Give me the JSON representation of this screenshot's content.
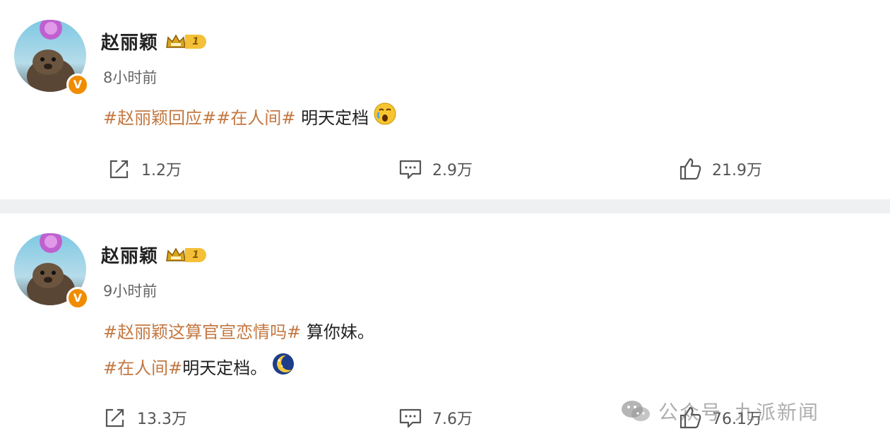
{
  "posts": [
    {
      "author": "赵丽颖",
      "level": "1",
      "time": "8小时前",
      "lines": [
        {
          "tags": [
            "#赵丽颖回应#",
            "#在人间#"
          ],
          "text": " 明天定档"
        }
      ],
      "share": "1.2万",
      "comment": "2.9万",
      "like": "21.9万"
    },
    {
      "author": "赵丽颖",
      "level": "1",
      "time": "9小时前",
      "lines": [
        {
          "tags": [
            "#赵丽颖这算官宣恋情吗#"
          ],
          "text": " 算你妹。"
        },
        {
          "tags": [
            "#在人间#"
          ],
          "text": "明天定档。"
        }
      ],
      "share": "13.3万",
      "comment": "7.6万",
      "like": "76.1万"
    }
  ],
  "watermark": {
    "label": "公众号",
    "name": "九派新闻"
  },
  "colors": {
    "tag": "#c37842",
    "badge": "#f08c00",
    "level": "#f4c038",
    "divider": "#eef0f2"
  },
  "icons": [
    "share-icon",
    "comment-icon",
    "like-icon",
    "crown-icon",
    "verified-icon",
    "wechat-icon"
  ]
}
